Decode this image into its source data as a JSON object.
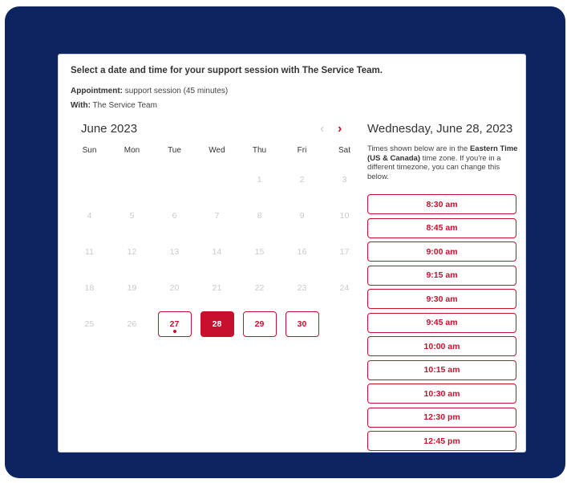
{
  "header": {
    "title": "Select a date and time for your support session with The Service Team.",
    "appointment_label": "Appointment:",
    "appointment_value": "support session (45 minutes)",
    "with_label": "With:",
    "with_value": "The Service Team"
  },
  "calendar": {
    "month_label": "June 2023",
    "prev_icon": "chevron-left-icon",
    "next_icon": "chevron-right-icon",
    "weekdays": [
      "Sun",
      "Mon",
      "Tue",
      "Wed",
      "Thu",
      "Fri",
      "Sat"
    ],
    "leading_blanks": 4,
    "days": [
      {
        "day": "1",
        "state": "disabled"
      },
      {
        "day": "2",
        "state": "disabled"
      },
      {
        "day": "3",
        "state": "disabled"
      },
      {
        "day": "4",
        "state": "disabled"
      },
      {
        "day": "5",
        "state": "disabled"
      },
      {
        "day": "6",
        "state": "disabled"
      },
      {
        "day": "7",
        "state": "disabled"
      },
      {
        "day": "8",
        "state": "disabled"
      },
      {
        "day": "9",
        "state": "disabled"
      },
      {
        "day": "10",
        "state": "disabled"
      },
      {
        "day": "11",
        "state": "disabled"
      },
      {
        "day": "12",
        "state": "disabled"
      },
      {
        "day": "13",
        "state": "disabled"
      },
      {
        "day": "14",
        "state": "disabled"
      },
      {
        "day": "15",
        "state": "disabled"
      },
      {
        "day": "16",
        "state": "disabled"
      },
      {
        "day": "17",
        "state": "disabled"
      },
      {
        "day": "18",
        "state": "disabled"
      },
      {
        "day": "19",
        "state": "disabled"
      },
      {
        "day": "20",
        "state": "disabled"
      },
      {
        "day": "21",
        "state": "disabled"
      },
      {
        "day": "22",
        "state": "disabled"
      },
      {
        "day": "23",
        "state": "disabled"
      },
      {
        "day": "24",
        "state": "disabled"
      },
      {
        "day": "25",
        "state": "disabled"
      },
      {
        "day": "26",
        "state": "disabled"
      },
      {
        "day": "27",
        "state": "available",
        "today": true
      },
      {
        "day": "28",
        "state": "selected"
      },
      {
        "day": "29",
        "state": "available"
      },
      {
        "day": "30",
        "state": "available"
      }
    ]
  },
  "times": {
    "date_title": "Wednesday, June 28, 2023",
    "note_prefix": "Times shown below are in the ",
    "note_tz": "Eastern Time (US & Canada)",
    "note_suffix": " time zone. If you're in a different timezone, you can change this below.",
    "slots": [
      "8:30 am",
      "8:45 am",
      "9:00 am",
      "9:15 am",
      "9:30 am",
      "9:45 am",
      "10:00 am",
      "10:15 am",
      "10:30 am",
      "12:30 pm",
      "12:45 pm"
    ]
  },
  "colors": {
    "frame_bg": "#0c2461",
    "accent": "#c8102e",
    "disabled_day": "#c9c9c9"
  }
}
